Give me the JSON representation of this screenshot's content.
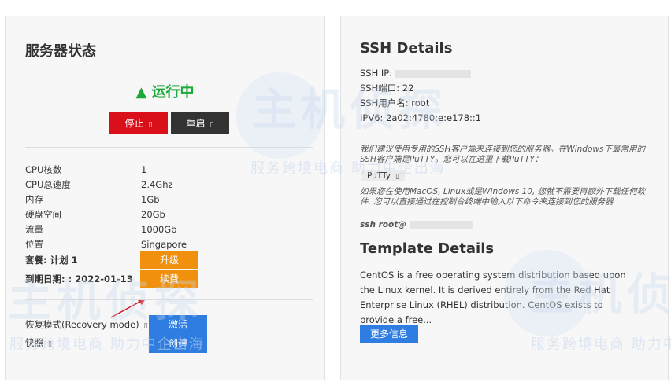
{
  "server": {
    "title": "服务器状态",
    "status": "▲ 运行中",
    "stop_label": "停止",
    "restart_label": "重启",
    "rows": [
      {
        "k": "CPU核数",
        "v": "1"
      },
      {
        "k": "CPU总速度",
        "v": "2.4Ghz"
      },
      {
        "k": "内存",
        "v": "1Gb"
      },
      {
        "k": "硬盘空间",
        "v": "20Gb"
      },
      {
        "k": "流量",
        "v": "1000Gb"
      },
      {
        "k": "位置",
        "v": "Singapore"
      }
    ],
    "plan_label": "套餐: 计划 1",
    "expiry_label": "到期日期: : 2022-01-13",
    "upgrade_label": "升级",
    "renew_label": "续费",
    "recovery_label": "恢复模式(Recovery mode)",
    "snapshot_label": "快照",
    "activate_label": "激活",
    "create_label": "创建"
  },
  "ssh": {
    "title": "SSH Details",
    "ip_label": "SSH IP:",
    "port_label": "SSH端口: 22",
    "user_label": "SSH用户名: root",
    "ipv6_label": "IPV6: 2a02:4780:e:e178::1",
    "note1": "我们建议使用专用的SSH客户端来连接到您的服务器。在Windows下最常用的SSH客户端是PuTTY。您可以在这里下载PuTTY：",
    "putty_label": "PuTTy",
    "note2": "如果您在使用MacOS, Linux或是Windows 10, 您就不需要再额外下载任何软件. 您可以直接通过在控制台终端中输入以下命令来连接到您的服务器",
    "ssh_cmd": "ssh root@"
  },
  "template": {
    "title": "Template Details",
    "description": "CentOS is a free operating system distribution based upon the Linux kernel. It is derived entirely from the Red Hat Enterprise Linux (RHEL) distribution. CentOS exists to provide a free...",
    "more_label": "更多信息"
  },
  "watermark": {
    "logo": "主机侦探",
    "text": "服务跨境电商 助力中企出海"
  },
  "colors": {
    "status_green": "#1aaa3a",
    "stop_red": "#d9101a",
    "upgrade_orange": "#f0900c",
    "action_blue": "#2f7de1"
  }
}
